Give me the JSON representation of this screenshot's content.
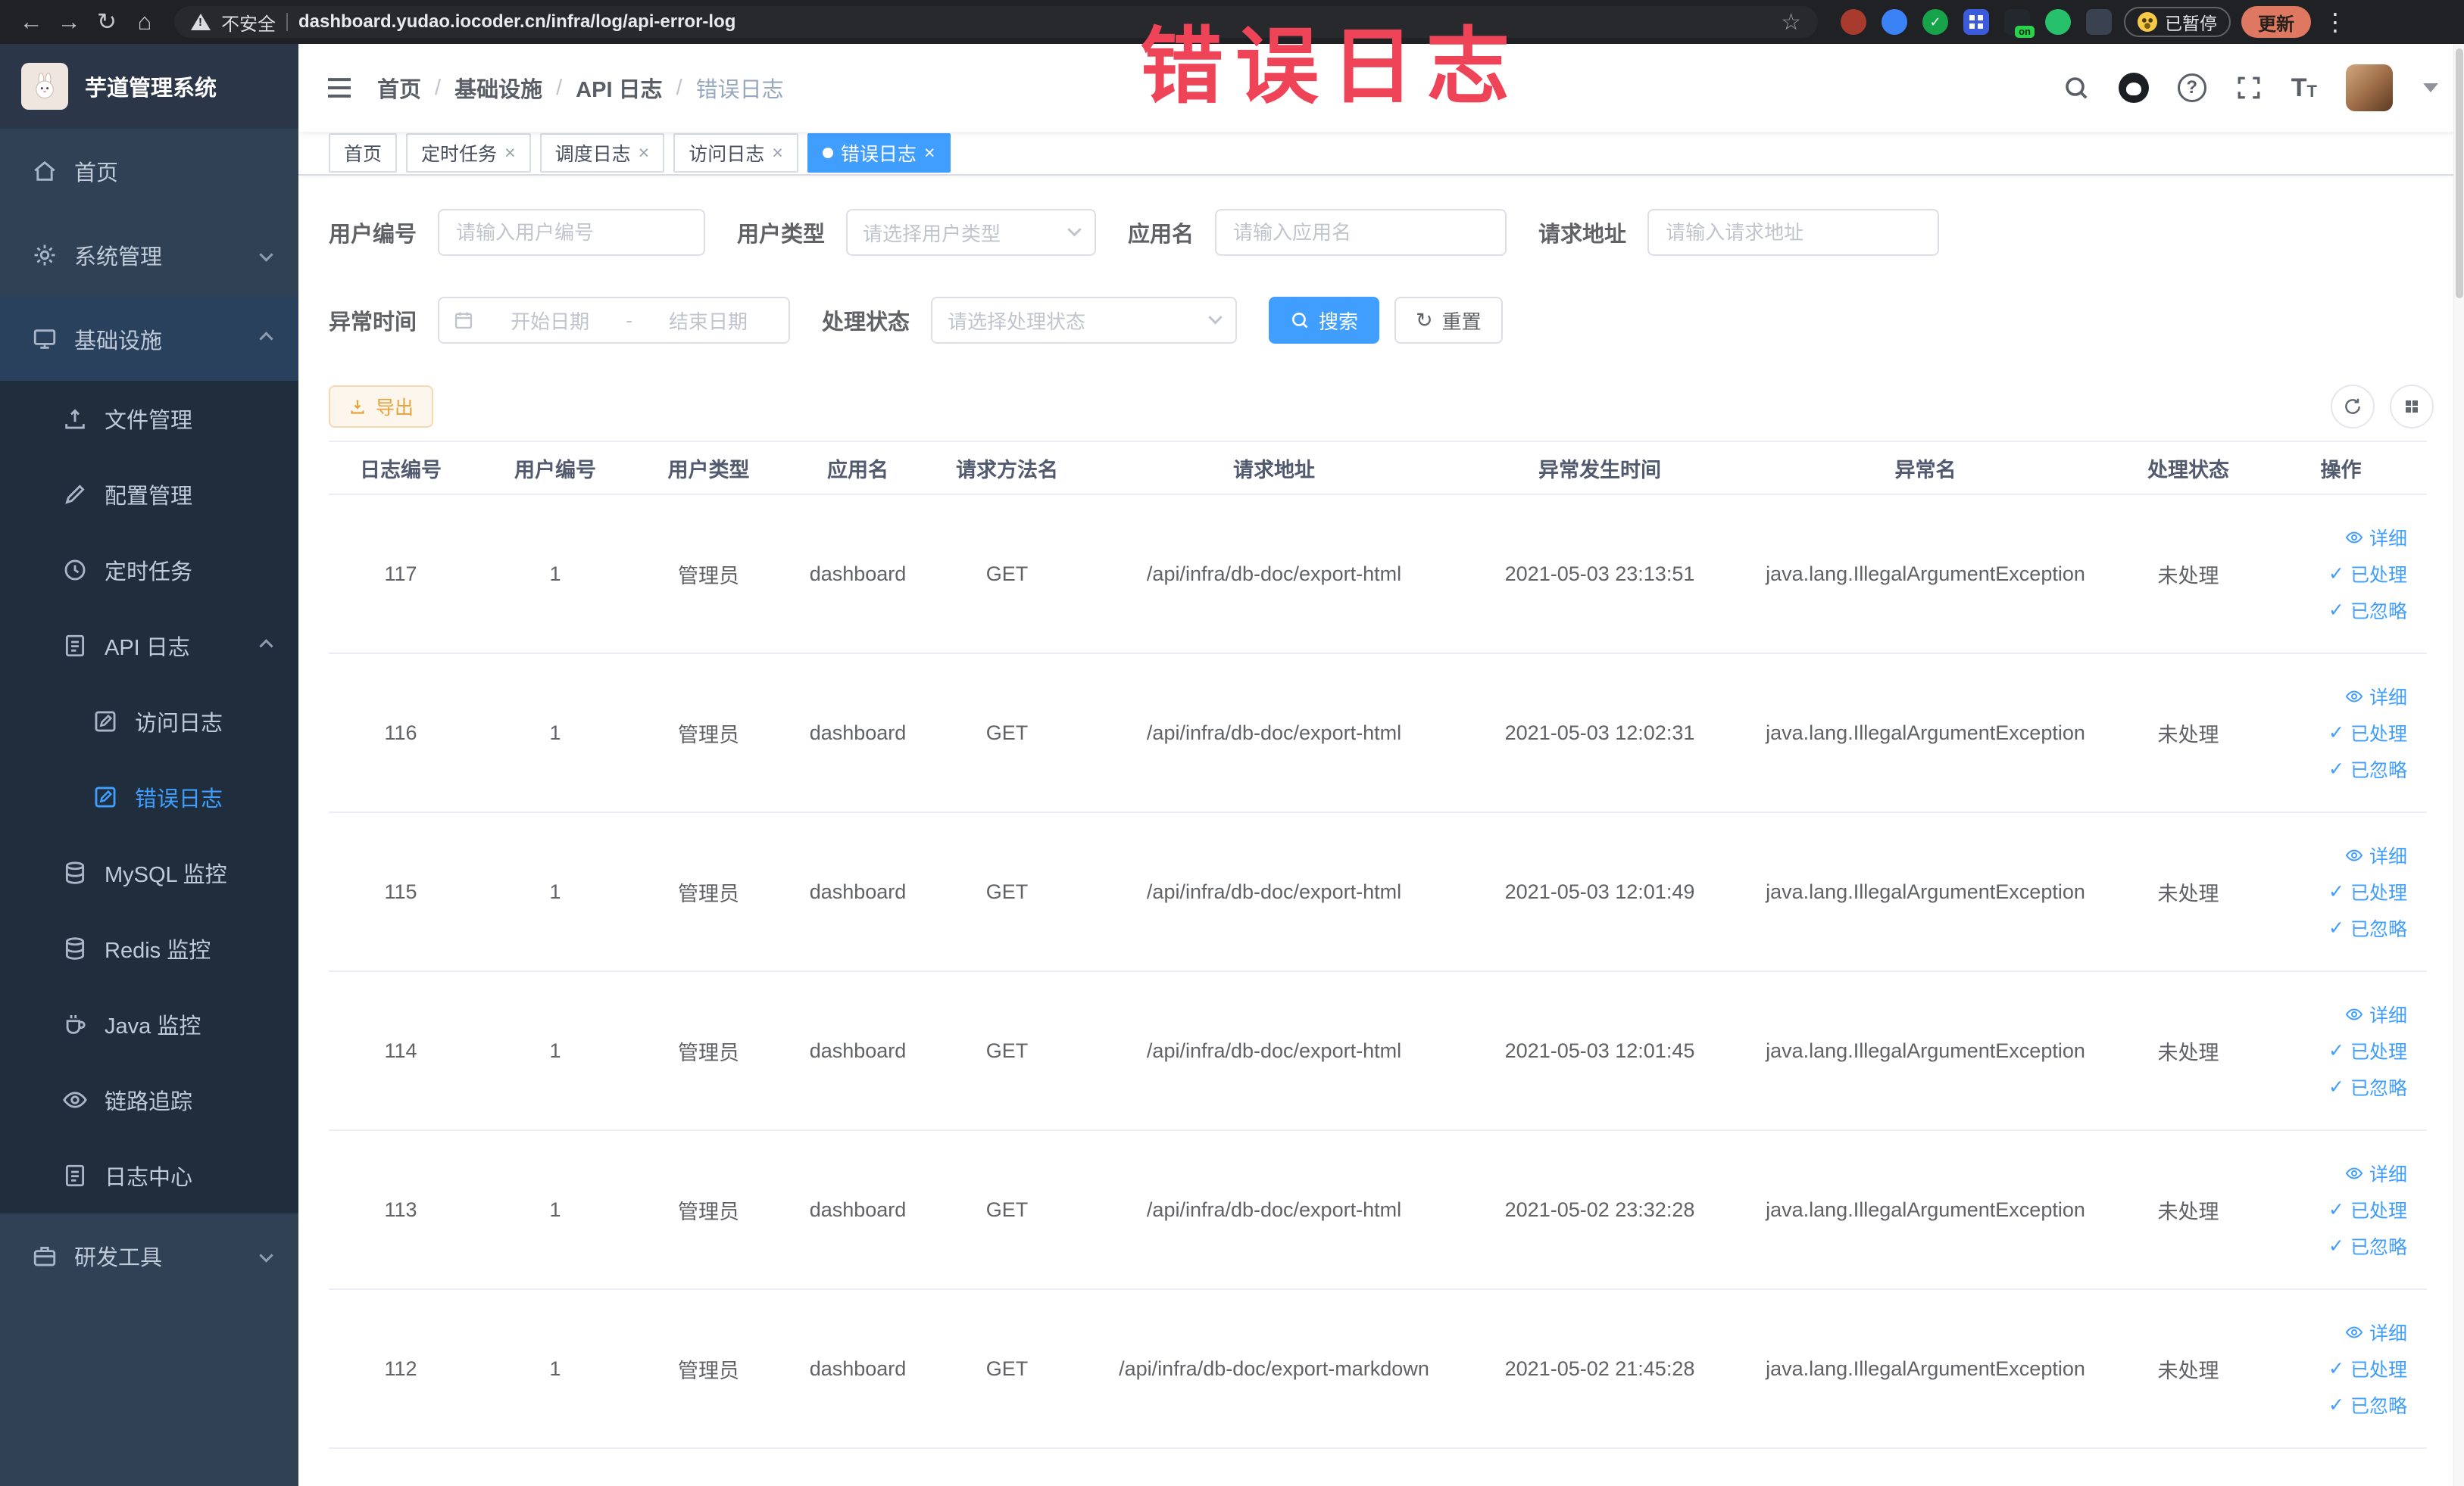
{
  "watermark_text": "错误日志",
  "icons": {
    "back": "←",
    "forward": "→",
    "reload": "↻",
    "home": "⌂",
    "star": "☆",
    "kebab": "⋮",
    "close": "×",
    "question": "?",
    "font_size": "T",
    "check": "✓"
  },
  "colors": {
    "primary": "#409eff",
    "warning": "#e6a23c",
    "watermark_red": "#ef4458",
    "sidebar_bg": "#304156",
    "submenu_bg": "#1f2d3d",
    "chrome_bg": "#202124"
  },
  "browser": {
    "security_label": "不安全",
    "url": "dashboard.yudao.iocoder.cn/infra/log/api-error-log",
    "paused_label": "已暂停",
    "update_label": "更新",
    "extension_on_badge": "on"
  },
  "sidebar": {
    "logo_title": "芋道管理系统",
    "home": "首页",
    "system_mgmt": "系统管理",
    "infra": "基础设施",
    "file_mgmt": "文件管理",
    "config_mgmt": "配置管理",
    "scheduled_jobs": "定时任务",
    "api_log": "API 日志",
    "access_log": "访问日志",
    "error_log": "错误日志",
    "mysql_monitor": "MySQL 监控",
    "redis_monitor": "Redis 监控",
    "java_monitor": "Java 监控",
    "trace": "链路追踪",
    "log_center": "日志中心",
    "dev_tools": "研发工具"
  },
  "header": {
    "breadcrumb": [
      "首页",
      "基础设施",
      "API 日志",
      "错误日志"
    ],
    "separator": "/"
  },
  "tabs": [
    {
      "label": "首页"
    },
    {
      "label": "定时任务"
    },
    {
      "label": "调度日志"
    },
    {
      "label": "访问日志"
    },
    {
      "label": "错误日志"
    }
  ],
  "filters": {
    "user_id_label": "用户编号",
    "user_id_placeholder": "请输入用户编号",
    "user_type_label": "用户类型",
    "user_type_placeholder": "请选择用户类型",
    "app_name_label": "应用名",
    "app_name_placeholder": "请输入应用名",
    "request_url_label": "请求地址",
    "request_url_placeholder": "请输入请求地址",
    "exception_time_label": "异常时间",
    "date_start_placeholder": "开始日期",
    "date_separator": "-",
    "date_end_placeholder": "结束日期",
    "process_status_label": "处理状态",
    "process_status_placeholder": "请选择处理状态",
    "search_label": "搜索",
    "reset_label": "重置"
  },
  "toolbar": {
    "export_label": "导出"
  },
  "table": {
    "headers": [
      "日志编号",
      "用户编号",
      "用户类型",
      "应用名",
      "请求方法名",
      "请求地址",
      "异常发生时间",
      "异常名",
      "处理状态",
      "操作"
    ],
    "actions": {
      "detail": "详细",
      "processed": "已处理",
      "ignored": "已忽略"
    },
    "rows": [
      {
        "log_id": "117",
        "user_id": "1",
        "user_type": "管理员",
        "app_name": "dashboard",
        "method": "GET",
        "url": "/api/infra/db-doc/export-html",
        "time": "2021-05-03 23:13:51",
        "exception": "java.lang.IllegalArgumentException",
        "status": "未处理"
      },
      {
        "log_id": "116",
        "user_id": "1",
        "user_type": "管理员",
        "app_name": "dashboard",
        "method": "GET",
        "url": "/api/infra/db-doc/export-html",
        "time": "2021-05-03 12:02:31",
        "exception": "java.lang.IllegalArgumentException",
        "status": "未处理"
      },
      {
        "log_id": "115",
        "user_id": "1",
        "user_type": "管理员",
        "app_name": "dashboard",
        "method": "GET",
        "url": "/api/infra/db-doc/export-html",
        "time": "2021-05-03 12:01:49",
        "exception": "java.lang.IllegalArgumentException",
        "status": "未处理"
      },
      {
        "log_id": "114",
        "user_id": "1",
        "user_type": "管理员",
        "app_name": "dashboard",
        "method": "GET",
        "url": "/api/infra/db-doc/export-html",
        "time": "2021-05-03 12:01:45",
        "exception": "java.lang.IllegalArgumentException",
        "status": "未处理"
      },
      {
        "log_id": "113",
        "user_id": "1",
        "user_type": "管理员",
        "app_name": "dashboard",
        "method": "GET",
        "url": "/api/infra/db-doc/export-html",
        "time": "2021-05-02 23:32:28",
        "exception": "java.lang.IllegalArgumentException",
        "status": "未处理"
      },
      {
        "log_id": "112",
        "user_id": "1",
        "user_type": "管理员",
        "app_name": "dashboard",
        "method": "GET",
        "url": "/api/infra/db-doc/export-markdown",
        "time": "2021-05-02 21:45:28",
        "exception": "java.lang.IllegalArgumentException",
        "status": "未处理"
      }
    ]
  }
}
